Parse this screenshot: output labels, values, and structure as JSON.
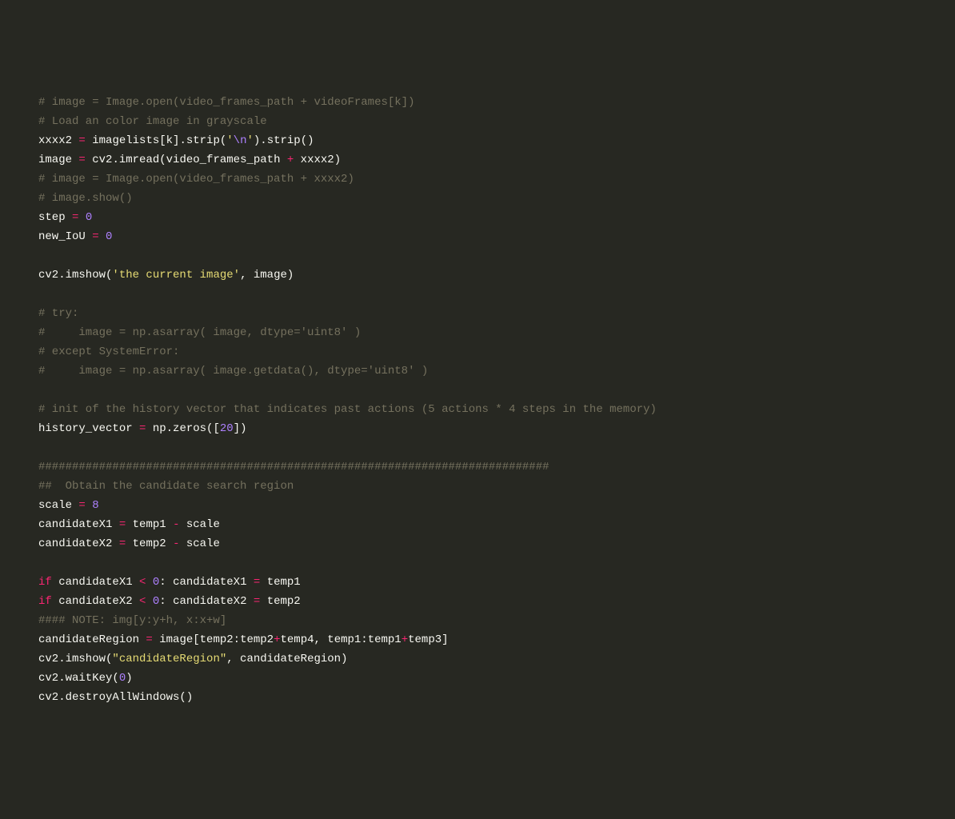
{
  "lines": {
    "l1_comment": "# image = Image.open(video_frames_path + videoFrames[k])",
    "l2_comment": "# Load an color image in grayscale",
    "l3": {
      "var": "xxxx2",
      "eq": " = ",
      "expr1": "imagelists[k].strip(",
      "str_open": "'",
      "escape": "\\n",
      "str_close": "'",
      "expr2": ").strip()"
    },
    "l4": {
      "var": "image",
      "eq": " = ",
      "expr1": "cv2.imread(video_frames_path ",
      "op": "+",
      "expr2": " xxxx2)"
    },
    "l5_comment": "# image = Image.open(video_frames_path + xxxx2)",
    "l6_comment": "# image.show()",
    "l7": {
      "var": "step",
      "eq": " = ",
      "num": "0"
    },
    "l8": {
      "var": "new_IoU",
      "eq": " = ",
      "num": "0"
    },
    "l10": {
      "expr1": "cv2.imshow(",
      "str": "'the current image'",
      "expr2": ", image)"
    },
    "l12_comment": "# try:",
    "l13_comment": "#     image = np.asarray( image, dtype='uint8' )",
    "l14_comment": "# except SystemError:",
    "l15_comment": "#     image = np.asarray( image.getdata(), dtype='uint8' )",
    "l17_comment": "# init of the history vector that indicates past actions (5 actions * 4 steps in the memory)",
    "l18": {
      "var": "history_vector",
      "eq": " = ",
      "expr1": "np.zeros([",
      "num": "20",
      "expr2": "])"
    },
    "l20_comment": "############################################################################",
    "l21_comment": "##  Obtain the candidate search region",
    "l22": {
      "var": "scale",
      "eq": " = ",
      "num": "8"
    },
    "l23": {
      "var": "candidateX1",
      "eq": " = ",
      "rhs1": "temp1 ",
      "op": "-",
      "rhs2": " scale"
    },
    "l24": {
      "var": "candidateX2",
      "eq": " = ",
      "rhs1": "temp2 ",
      "op": "-",
      "rhs2": " scale"
    },
    "l26": {
      "kw": "if",
      "cond1": " candidateX1 ",
      "op1": "<",
      "sp1": " ",
      "num": "0",
      "colon": ": ",
      "lhs": "candidateX1",
      "eq": " = ",
      "rhs": "temp1"
    },
    "l27": {
      "kw": "if",
      "cond1": " candidateX2 ",
      "op1": "<",
      "sp1": " ",
      "num": "0",
      "colon": ": ",
      "lhs": "candidateX2",
      "eq": " = ",
      "rhs": "temp2"
    },
    "l28_comment": "#### NOTE: img[y:y+h, x:x+w]",
    "l29": {
      "var": "candidateRegion",
      "eq": " = ",
      "p1": "image[temp2:temp2",
      "op1": "+",
      "p2": "temp4, temp1:temp1",
      "op2": "+",
      "p3": "temp3]"
    },
    "l30": {
      "expr1": "cv2.imshow(",
      "str": "\"candidateRegion\"",
      "expr2": ", candidateRegion)"
    },
    "l31": {
      "expr1": "cv2.waitKey(",
      "num": "0",
      "expr2": ")"
    },
    "l32": {
      "expr": "cv2.destroyAllWindows()"
    }
  }
}
